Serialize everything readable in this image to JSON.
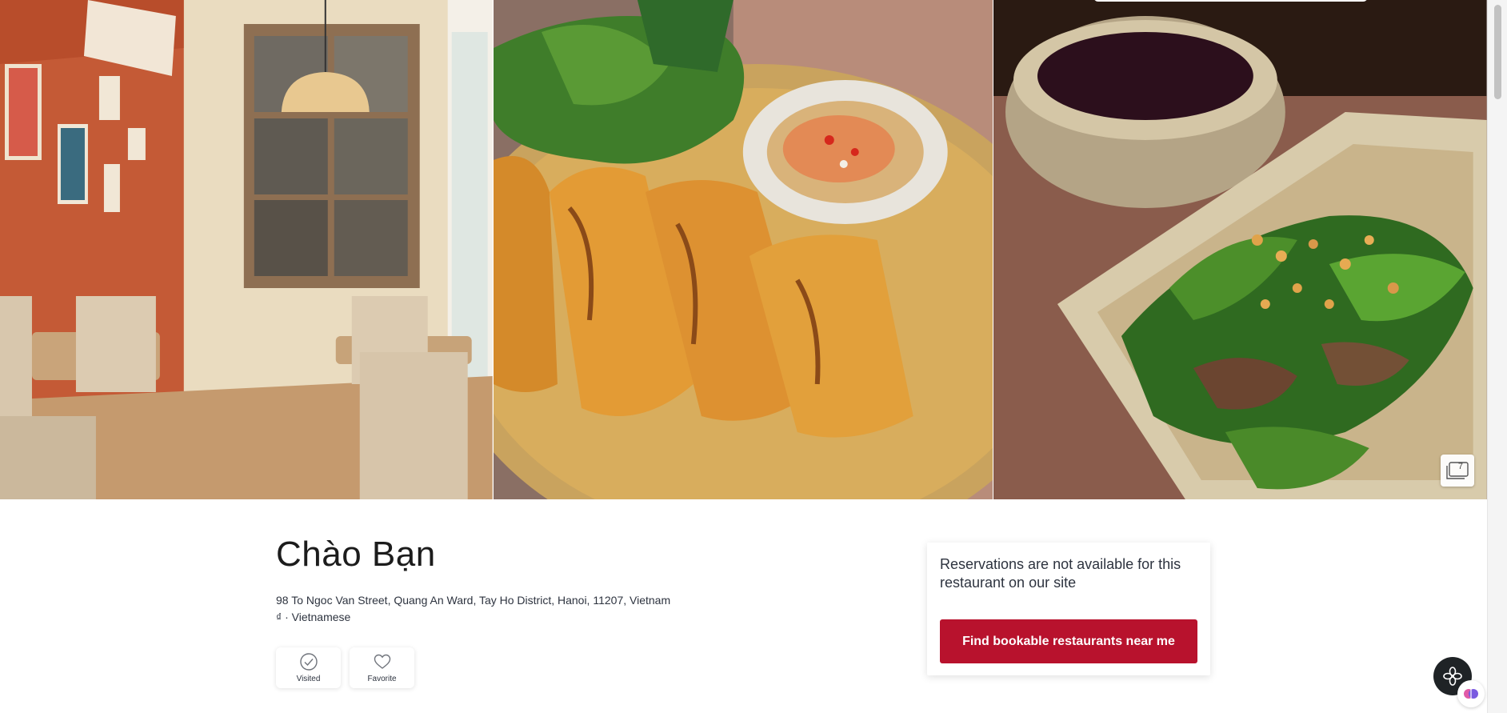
{
  "gallery": {
    "photo_count": "7",
    "photos": [
      {
        "name": "interior-photo"
      },
      {
        "name": "spring-rolls-photo"
      },
      {
        "name": "beef-salad-photo"
      }
    ]
  },
  "restaurant": {
    "name": "Chào Bạn",
    "address": "98 To Ngoc Van Street, Quang An Ward, Tay Ho District, Hanoi, 11207, Vietnam",
    "meta": "₫ · Vietnamese"
  },
  "actions": {
    "visited_label": "Visited",
    "favorite_label": "Favorite"
  },
  "reservation": {
    "message": "Reservations are not available for this restaurant on our site",
    "cta_label": "Find bookable restaurants near me"
  },
  "colors": {
    "accent": "#b8122d",
    "text": "#2d333f"
  },
  "icons": {
    "visited": "check-circle-icon",
    "favorite": "heart-icon",
    "photo_count": "photo-stack-icon",
    "assistant": "assistant-icon"
  }
}
